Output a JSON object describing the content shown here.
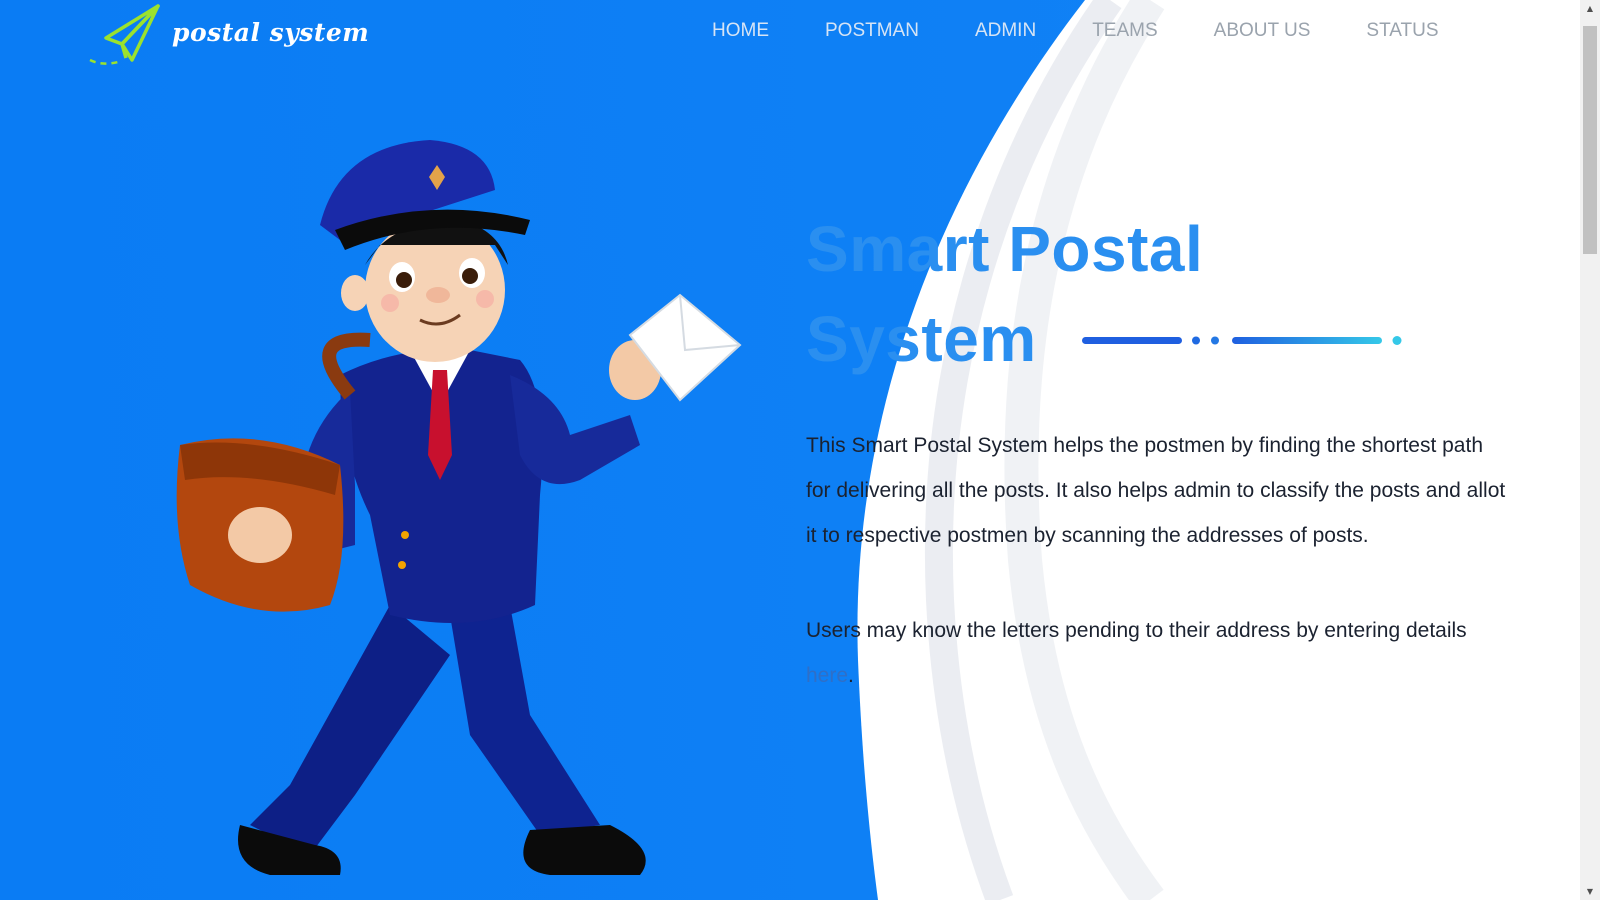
{
  "brand": {
    "logo_text": "postal system",
    "logo_icon": "paper-plane-icon"
  },
  "nav": {
    "items": [
      {
        "label": "HOME"
      },
      {
        "label": "POSTMAN"
      },
      {
        "label": "ADMIN"
      },
      {
        "label": "TEAMS"
      },
      {
        "label": "ABOUT US"
      },
      {
        "label": "STATUS"
      }
    ]
  },
  "hero": {
    "title_line1": "Smart Postal",
    "title_line2": "System",
    "description": "This Smart Postal System helps the postmen by finding the shortest path for delivering all the posts. It also helps admin to classify the posts and allot it to respective postmen by scanning the addresses of posts.",
    "users_text": "Users may know the letters pending to their address by entering details ",
    "link_text": "here",
    "link_suffix": "."
  },
  "colors": {
    "primary_blue": "#0f7ef5",
    "title_blue": "#2a8ff0",
    "logo_green": "#9be22e",
    "accent_cyan": "#35c8e8"
  },
  "illustration": {
    "icon": "postman-illustration"
  }
}
